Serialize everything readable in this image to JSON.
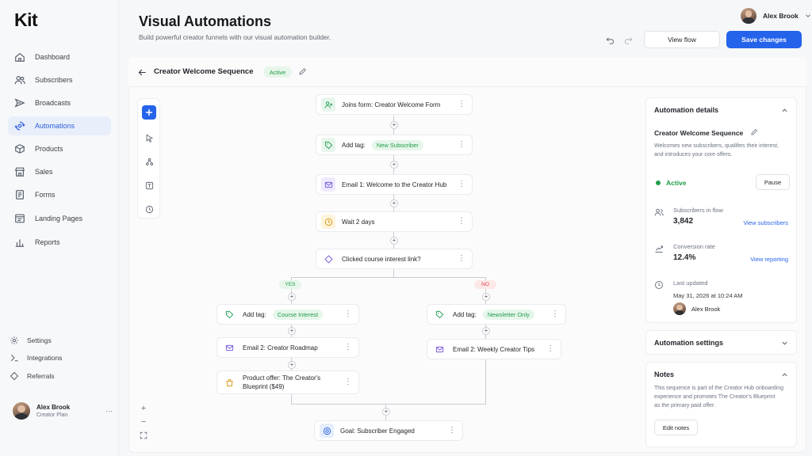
{
  "app": {
    "logo": "Kit"
  },
  "sidebar": {
    "items": [
      {
        "label": "Dashboard",
        "icon": "home-icon"
      },
      {
        "label": "Subscribers",
        "icon": "users-icon"
      },
      {
        "label": "Broadcasts",
        "icon": "send-icon"
      },
      {
        "label": "Automations",
        "icon": "automation-icon",
        "active": true
      },
      {
        "label": "Products",
        "icon": "box-icon"
      },
      {
        "label": "Sales",
        "icon": "store-icon"
      },
      {
        "label": "Forms",
        "icon": "form-icon"
      },
      {
        "label": "Landing Pages",
        "icon": "page-icon"
      },
      {
        "label": "Reports",
        "icon": "chart-icon"
      }
    ],
    "bottom": [
      {
        "label": "Settings",
        "icon": "gear-icon"
      },
      {
        "label": "Integrations",
        "icon": "plug-icon"
      },
      {
        "label": "Referrals",
        "icon": "gift-icon"
      }
    ],
    "user": {
      "name": "Alex Brook",
      "plan": "Creator Plan",
      "menu": "···"
    }
  },
  "header": {
    "title": "Visual Automations",
    "subtitle": "Build powerful creator funnels with our visual automation builder.",
    "user_name": "Alex Brook",
    "view_flow": "View flow",
    "save": "Save changes"
  },
  "flow": {
    "name": "Creator Welcome Sequence",
    "status": "Active",
    "nodes": {
      "trigger": "Joins form: Creator Welcome Form",
      "tag1_prefix": "Add tag:",
      "tag1_value": "New Subscriber",
      "email1": "Email 1:  Welcome to the Creator Hub",
      "wait": "Wait 2 days",
      "condition": "Clicked course interest link?",
      "yes": "YES",
      "no": "NO",
      "yes_tag_prefix": "Add tag:",
      "yes_tag_value": "Course Interest",
      "yes_email": "Email 2:  Creator Roadmap",
      "yes_offer_1": "Product offer: The Creator's",
      "yes_offer_2": "Blueprint ($49)",
      "no_tag_prefix": "Add tag:",
      "no_tag_value": "Newsletter Only",
      "no_email": "Email 2:  Weekly Creator Tips",
      "goal": "Goal:  Subscriber Engaged"
    }
  },
  "details": {
    "title": "Automation details",
    "name": "Creator Welcome Sequence",
    "description_1": "Welcomes new subscribers, qualifies their interest,",
    "description_2": "and introduces your core offers.",
    "status": "Active",
    "pause": "Pause",
    "subscribers_label": "Subscribers in flow",
    "subscribers_value": "3,842",
    "subscribers_link": "View subscribers",
    "conversion_label": "Conversion rate",
    "conversion_value": "12.4%",
    "conversion_link": "View reporting",
    "updated_label": "Last updated",
    "updated_value": "May 31, 2026 at 10:24 AM",
    "updated_by": "Alex Brook"
  },
  "settings_panel": {
    "title": "Automation settings"
  },
  "notes": {
    "title": "Notes",
    "line1": "This sequence is part of the Creator Hub onboarding",
    "line2": "experience and promotes The Creator's Blueprint",
    "line3": "as the primary paid offer.",
    "edit": "Edit notes"
  },
  "colors": {
    "accent": "#2563eb",
    "success": "#1f9d4a",
    "danger": "#d54545"
  }
}
